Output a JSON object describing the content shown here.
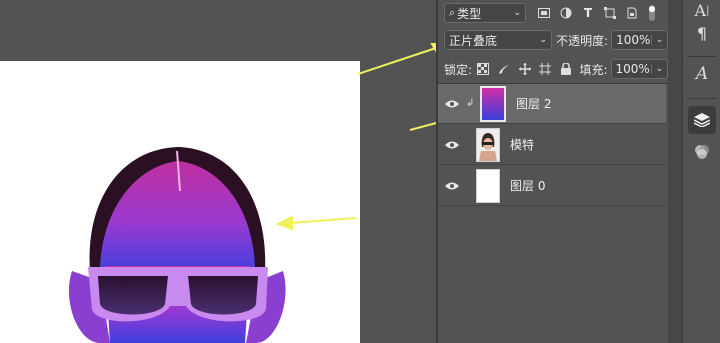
{
  "filter": {
    "kind_label": "类型"
  },
  "blend": {
    "mode": "正片叠底",
    "opacity_label": "不透明度:",
    "opacity_value": "100%"
  },
  "lock": {
    "label": "锁定:",
    "fill_label": "填充:",
    "fill_value": "100%"
  },
  "layers": [
    {
      "name": "图层 2"
    },
    {
      "name": "模特"
    },
    {
      "name": "图层 0"
    }
  ],
  "right_toolbar": {
    "char_glyph": "A",
    "para_glyph": "¶",
    "glyph_style": "A"
  },
  "colors": {
    "gradient_top": "#d12fa6",
    "gradient_bottom": "#3a3fd8",
    "arrow": "#f2f05a",
    "selected_row": "#6a6a6a"
  }
}
